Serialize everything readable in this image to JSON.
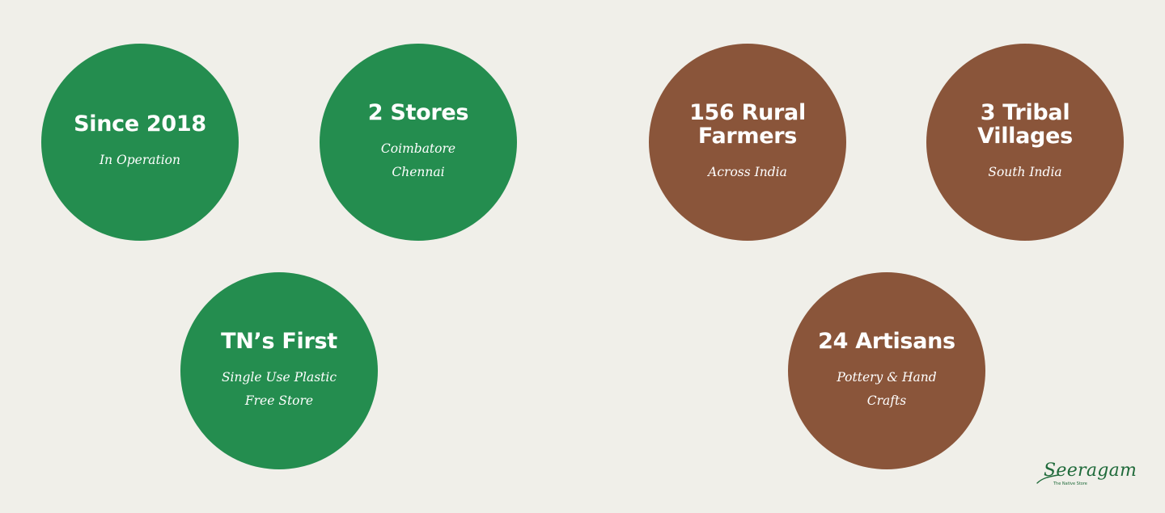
{
  "colors": {
    "background": "#f0efe9",
    "green": "#248d4f",
    "brown": "#8a553a",
    "text": "#ffffff",
    "logo": "#1f6a3a"
  },
  "stats": [
    {
      "title": "Since 2018",
      "lines": [
        "In Operation"
      ]
    },
    {
      "title": "2 Stores",
      "lines": [
        "Coimbatore",
        "Chennai"
      ]
    },
    {
      "title": "TN’s First",
      "lines": [
        "Single Use Plastic",
        "Free Store"
      ]
    },
    {
      "title": "156 Rural Farmers",
      "lines": [
        "Across India"
      ]
    },
    {
      "title": "3 Tribal Villages",
      "lines": [
        "South India"
      ]
    },
    {
      "title": "24 Artisans",
      "lines": [
        "Pottery & Hand Crafts"
      ]
    }
  ],
  "logo": {
    "name": "Seeragam",
    "tagline": "The Native Store"
  }
}
